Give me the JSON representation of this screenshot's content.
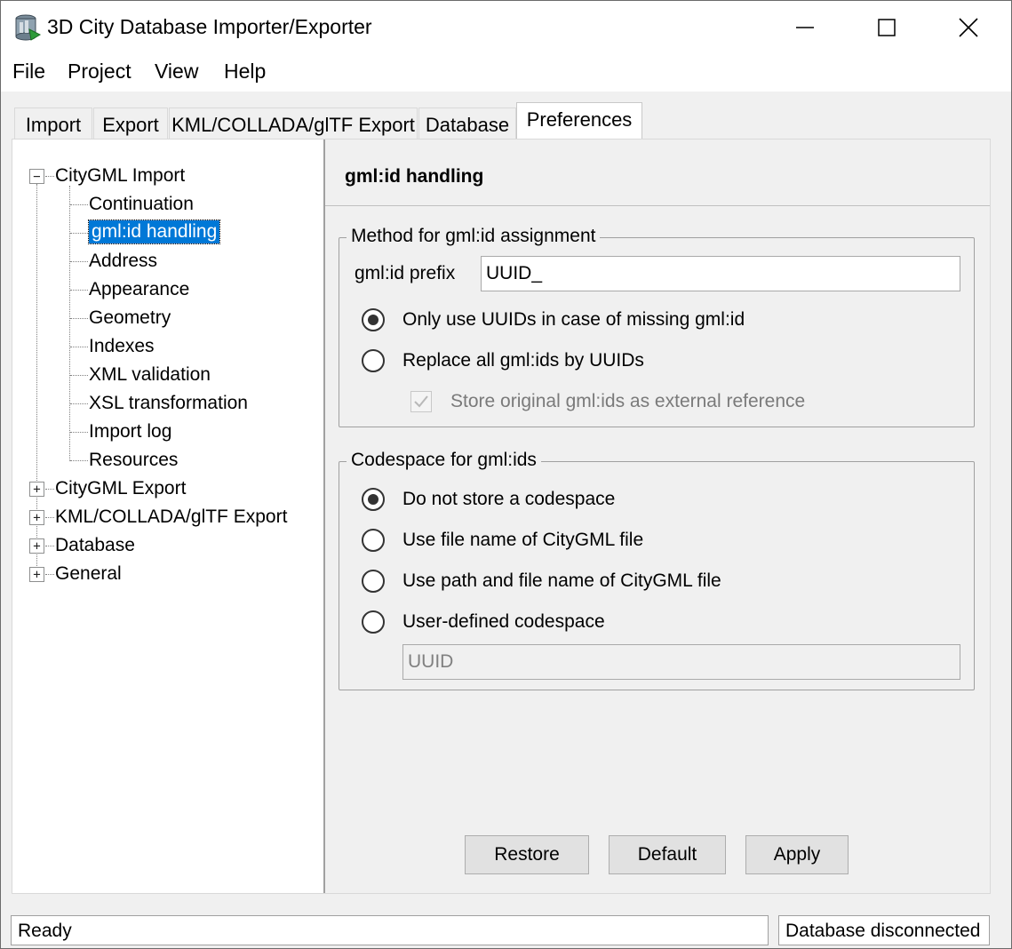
{
  "window": {
    "title": "3D City Database Importer/Exporter",
    "icon": "database-icon"
  },
  "menu": [
    "File",
    "Project",
    "View",
    "Help"
  ],
  "tabs": [
    {
      "label": "Import",
      "active": false
    },
    {
      "label": "Export",
      "active": false
    },
    {
      "label": "KML/COLLADA/glTF Export",
      "active": false
    },
    {
      "label": "Database",
      "active": false
    },
    {
      "label": "Preferences",
      "active": true
    }
  ],
  "tree": {
    "citygml_import": {
      "label": "CityGML Import",
      "expanded": true,
      "children": [
        "Continuation",
        "gml:id handling",
        "Address",
        "Appearance",
        "Geometry",
        "Indexes",
        "XML validation",
        "XSL transformation",
        "Import log",
        "Resources"
      ],
      "selected": "gml:id handling"
    },
    "collapsed": [
      "CityGML Export",
      "KML/COLLADA/glTF Export",
      "Database",
      "General"
    ]
  },
  "panel": {
    "title": "gml:id handling",
    "method_group": {
      "legend": "Method for gml:id assignment",
      "prefix_label": "gml:id prefix",
      "prefix_value": "UUID_",
      "options": [
        {
          "label": "Only use UUIDs in case of missing gml:id",
          "checked": true
        },
        {
          "label": "Replace all gml:ids by UUIDs",
          "checked": false
        }
      ],
      "store_original_label": "Store original gml:ids as external reference",
      "store_original_checked": true,
      "store_original_enabled": false
    },
    "codespace_group": {
      "legend": "Codespace for gml:ids",
      "options": [
        {
          "label": "Do not store a codespace",
          "checked": true
        },
        {
          "label": "Use file name of CityGML file",
          "checked": false
        },
        {
          "label": "Use path and file name of CityGML file",
          "checked": false
        },
        {
          "label": "User-defined codespace",
          "checked": false
        }
      ],
      "user_codespace_value": "UUID"
    },
    "buttons": {
      "restore": "Restore",
      "default": "Default",
      "apply": "Apply"
    }
  },
  "status": {
    "left": "Ready",
    "right": "Database disconnected"
  }
}
